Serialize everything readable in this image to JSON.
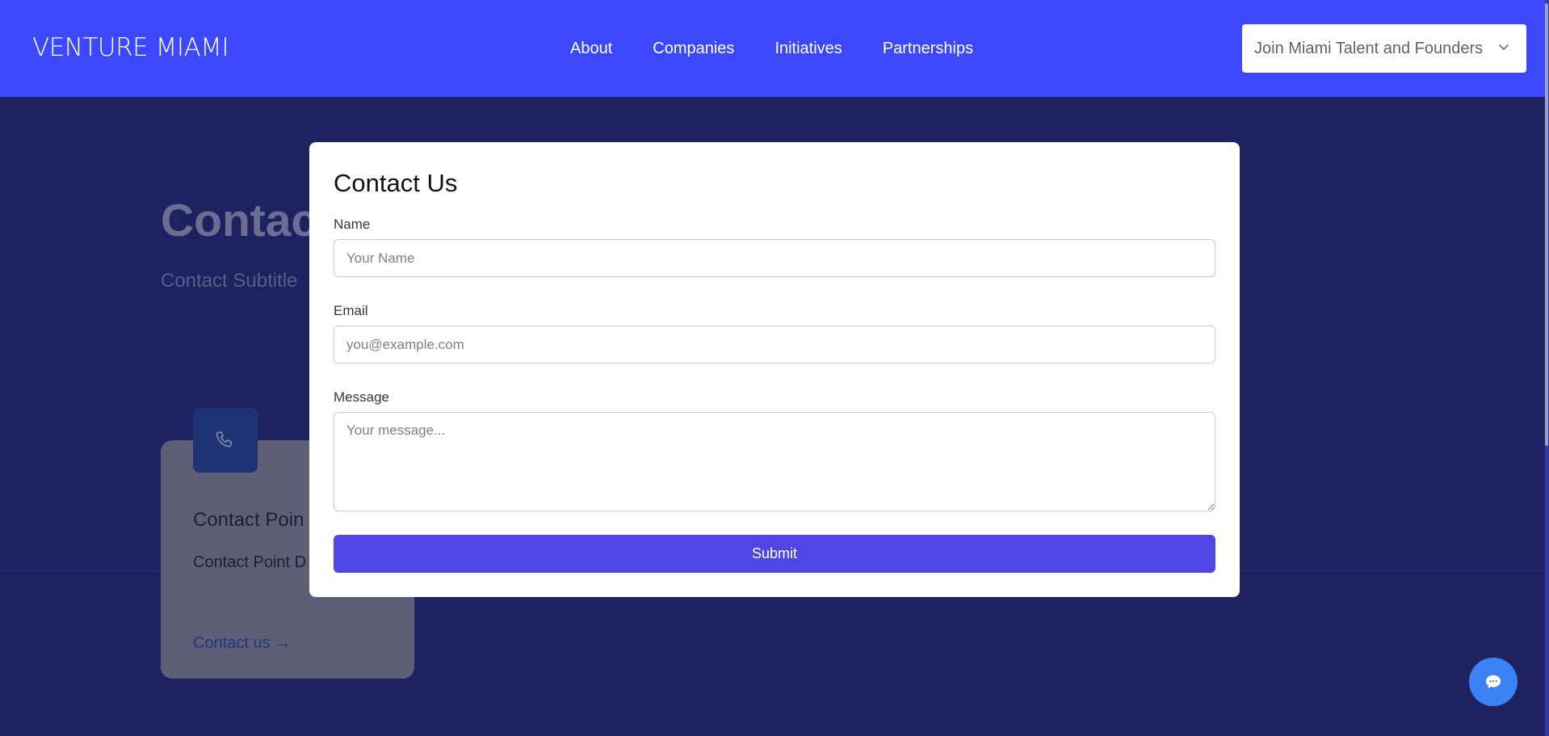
{
  "header": {
    "logo": "VENTURE MIAMI",
    "logo_mark": "·",
    "nav": [
      "About",
      "Companies",
      "Initiatives",
      "Partnerships"
    ],
    "join_select": {
      "value": "Join Miami Talent and Founders",
      "icon": "chevron-down-icon"
    }
  },
  "background": {
    "title": "Contact",
    "subtitle": "Contact Subtitle",
    "card": {
      "icon": "phone-icon",
      "title": "Contact Poin",
      "description": "Contact Point D",
      "link": "Contact us →"
    }
  },
  "modal": {
    "title": "Contact Us",
    "name_label": "Name",
    "name_placeholder": "Your Name",
    "email_label": "Email",
    "email_placeholder": "you@example.com",
    "message_label": "Message",
    "message_placeholder": "Your message...",
    "submit_label": "Submit"
  },
  "chat": {
    "icon": "chat-bubble-icon"
  },
  "colors": {
    "header_bg": "#3b48fb",
    "page_bg": "#1e2260",
    "submit_bg": "#4f46e5",
    "chat_bg": "#3b82f6"
  }
}
